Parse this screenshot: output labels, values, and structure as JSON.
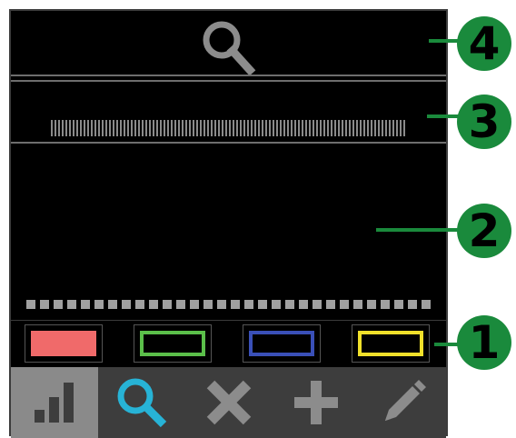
{
  "colors": {
    "screen_bg": "#000000",
    "toolbar_bg": "#3d3d3d",
    "active_tool_bg": "#8a8a8a",
    "callout_green": "#1a8a3c",
    "search_icon_gray": "#8c8c8c",
    "search_icon_active": "#27b3d6"
  },
  "header": {
    "icon": "search-icon"
  },
  "swatches": [
    {
      "name": "red",
      "color": "#f06a6a",
      "filled": true
    },
    {
      "name": "green",
      "color": "#5bbf4a",
      "filled": false
    },
    {
      "name": "blue",
      "color": "#3a50b8",
      "filled": false
    },
    {
      "name": "yellow",
      "color": "#f0e02a",
      "filled": false
    }
  ],
  "toolbar": {
    "tools": [
      {
        "icon": "bar-chart-icon",
        "active": true
      },
      {
        "icon": "search-icon",
        "active": false
      },
      {
        "icon": "close-icon",
        "active": false
      },
      {
        "icon": "plus-icon",
        "active": false
      },
      {
        "icon": "pencil-icon",
        "active": false
      }
    ]
  },
  "callouts": {
    "c1": "1",
    "c2": "2",
    "c3": "3",
    "c4": "4"
  }
}
